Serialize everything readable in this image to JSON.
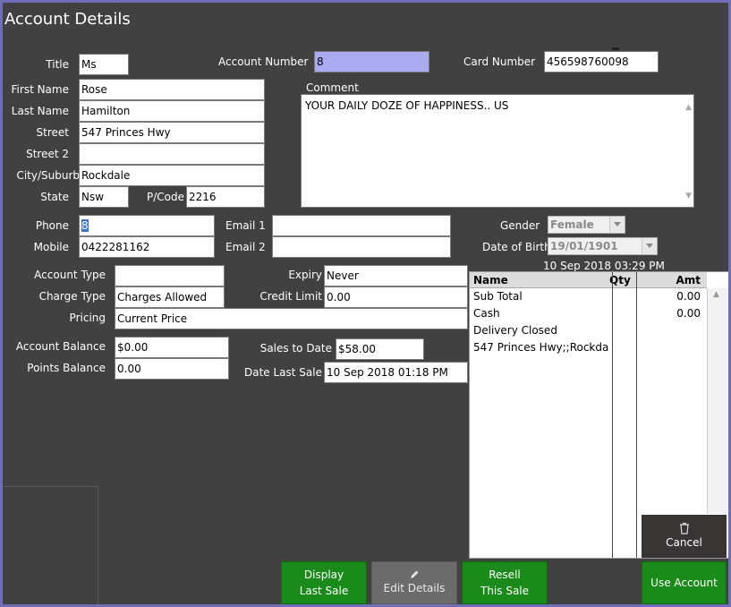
{
  "window": {
    "title": "Account Details"
  },
  "labels": {
    "title": "Title",
    "first_name": "First Name",
    "last_name": "Last Name",
    "street": "Street",
    "street2": "Street 2",
    "city": "City/Suburb",
    "state": "State",
    "pcode": "P/Code",
    "account_number": "Account Number",
    "card_number": "Card Number",
    "comment": "Comment",
    "phone": "Phone",
    "mobile": "Mobile",
    "email1": "Email 1",
    "email2": "Email 2",
    "gender": "Gender",
    "dob": "Date of Birth",
    "account_type": "Account Type",
    "charge_type": "Charge Type",
    "pricing": "Pricing",
    "expiry": "Expiry",
    "credit_limit": "Credit Limit",
    "account_balance": "Account Balance",
    "points_balance": "Points Balance",
    "sales_to_date": "Sales to Date",
    "date_last_sale": "Date Last Sale"
  },
  "values": {
    "title": "Ms",
    "first_name": "Rose",
    "last_name": "Hamilton",
    "street": "547 Princes Hwy",
    "street2": "",
    "city": "Rockdale",
    "state": "Nsw",
    "pcode": "2216",
    "account_number": "8",
    "card_number": "456598760098",
    "comment": "YOUR DAILY DOZE OF HAPPINESS.. US",
    "phone": "8",
    "mobile": "0422281162",
    "email1": "",
    "email2": "",
    "gender": "Female",
    "dob": "19/01/1901",
    "account_type": "",
    "charge_type": "Charges Allowed",
    "pricing": "Current Price",
    "expiry": "Never",
    "credit_limit": "0.00",
    "account_balance": "$0.00",
    "points_balance": "0.00",
    "sales_to_date": "$58.00",
    "date_last_sale": "10 Sep 2018 01:18 PM"
  },
  "last_sale": {
    "timestamp": "10 Sep 2018 03:29 PM",
    "headers": {
      "name": "Name",
      "qty": "Qty",
      "amt": "Amt"
    },
    "rows": [
      {
        "name": "Sub Total",
        "qty": "",
        "amt": "0.00"
      },
      {
        "name": "Cash",
        "qty": "",
        "amt": "0.00"
      },
      {
        "name": "Delivery Closed",
        "qty": "",
        "amt": ""
      },
      {
        "name": "547 Princes Hwy;;Rockda",
        "qty": "",
        "amt": ""
      }
    ]
  },
  "buttons": {
    "display_last_sale": "Display Last Sale",
    "edit_details": "Edit Details",
    "resell_this_sale": "Resell This Sale",
    "use_account": "Use Account",
    "cancel": "Cancel"
  },
  "icons": {
    "edit": "pencil-icon",
    "cancel": "trash-icon"
  },
  "colors": {
    "accent_green": "#1a8a1a",
    "frame_border": "#6f6fb8",
    "selected_field": "#aaaaf0"
  }
}
